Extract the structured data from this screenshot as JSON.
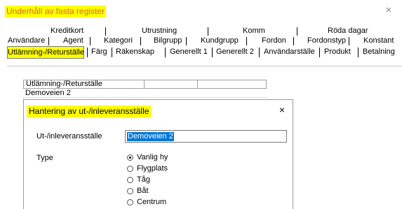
{
  "window": {
    "title": "Underhåll av fasta register",
    "close_icon": "×"
  },
  "tabs": {
    "row1": [
      "Kreditkort",
      "Utrustning",
      "Komm",
      "Röda dagar"
    ],
    "row2": [
      "Användare",
      "Agent",
      "Kategori",
      "Bilgrupp",
      "Kundgrupp",
      "Fordon",
      "Fordonstyp",
      "Konstant"
    ],
    "row3": [
      "Utlämning-/Returställe",
      "Färg",
      "Räkenskap",
      "Generellt 1",
      "Generellt 2",
      "Användarställe",
      "Produkt",
      "Betalning"
    ],
    "active": "Utlämning-/Returställe"
  },
  "list": {
    "column_header": "Utlämning-/Returställe",
    "rows": [
      "Demoveien 2"
    ]
  },
  "dialog": {
    "title": "Hantering av ut-/inleveransställe",
    "close_icon": "×",
    "field_label": "Ut-/inleveransställe",
    "field_value": "Demoveien 2",
    "type_label": "Type",
    "options": [
      "Vanlig hy",
      "Flygplats",
      "Tåg",
      "Båt",
      "Centrum"
    ],
    "selected": "Vanlig hy"
  },
  "colors": {
    "highlight": "#ffff00",
    "accent_text": "#d96b1f",
    "selection": "#0078d7"
  }
}
